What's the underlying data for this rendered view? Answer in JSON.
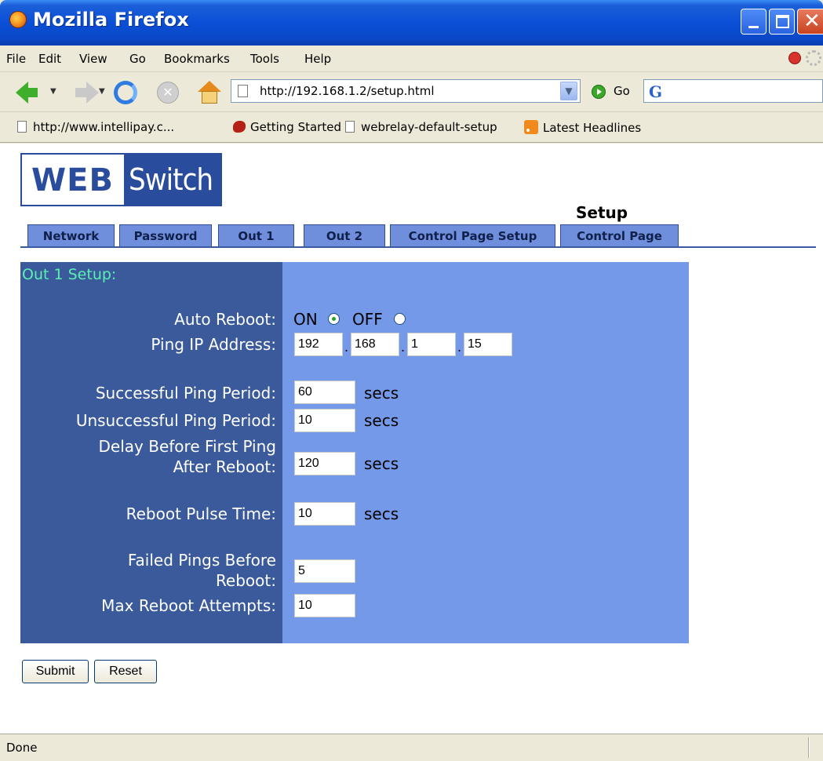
{
  "window": {
    "title": "Mozilla Firefox"
  },
  "menu": [
    "File",
    "Edit",
    "View",
    "Go",
    "Bookmarks",
    "Tools",
    "Help"
  ],
  "nav": {
    "url": "http://192.168.1.2/setup.html",
    "go_label": "Go"
  },
  "bookmarks": [
    {
      "label": "http://www.intellipay.c...",
      "icon": "page-icon"
    },
    {
      "label": "Getting Started",
      "icon": "firefox-icon"
    },
    {
      "label": "webrelay-default-setup",
      "icon": "page-icon"
    },
    {
      "label": "Latest Headlines",
      "icon": "rss-icon"
    }
  ],
  "page": {
    "logo": {
      "web": "WEB",
      "switch": "Switch"
    },
    "heading": "Setup",
    "tabs": [
      "Network",
      "Password",
      "Out 1",
      "Out 2",
      "Control Page Setup",
      "Control Page"
    ],
    "panel_title": "Out 1 Setup:",
    "auto_reboot": {
      "label": "Auto Reboot:",
      "on": "ON",
      "off": "OFF",
      "selected": "ON"
    },
    "ping_ip": {
      "label": "Ping IP Address:",
      "octets": [
        "192",
        "168",
        "1",
        "15"
      ]
    },
    "successful_ping": {
      "label": "Successful Ping Period:",
      "value": "60",
      "unit": "secs"
    },
    "unsuccessful_ping": {
      "label": "Unsuccessful Ping Period:",
      "value": "10",
      "unit": "secs"
    },
    "delay_first_ping": {
      "label_line1": "Delay Before First Ping",
      "label_line2": "After Reboot:",
      "value": "120",
      "unit": "secs"
    },
    "reboot_pulse": {
      "label": "Reboot Pulse Time:",
      "value": "10",
      "unit": "secs"
    },
    "failed_pings": {
      "label_line1": "Failed Pings Before",
      "label_line2": "Reboot:",
      "value": "5"
    },
    "max_reboot": {
      "label": "Max Reboot Attempts:",
      "value": "10"
    },
    "buttons": {
      "submit": "Submit",
      "reset": "Reset"
    }
  },
  "status": {
    "text": "Done"
  },
  "colors": {
    "tab_bg": "#6f8fdd",
    "panel_dark": "#3a5a9c",
    "panel_light": "#7499e8",
    "panel_title": "#5af0b0",
    "titlebar": "#0a4fd6"
  }
}
